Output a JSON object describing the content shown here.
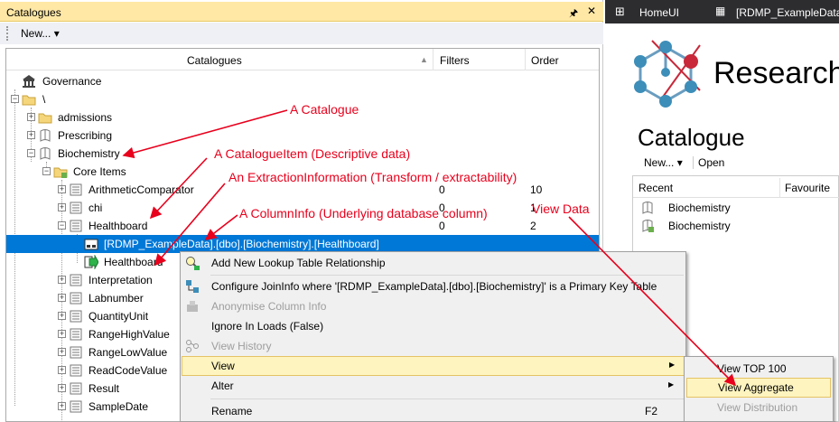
{
  "left_panel": {
    "title": "Catalogues",
    "pin_icon": "pin-icon",
    "close_icon": "close-icon",
    "toolbar": {
      "new_label": "New..."
    },
    "columns": {
      "catalogues": "Catalogues",
      "filters": "Filters",
      "order": "Order"
    },
    "tree": {
      "governance": "Governance",
      "root": "\\",
      "admissions": "admissions",
      "prescribing": "Prescribing",
      "biochemistry": "Biochemistry",
      "core_items": "Core Items",
      "items": [
        {
          "label": "ArithmeticComparator",
          "filters": "0",
          "order": "10"
        },
        {
          "label": "chi",
          "filters": "0",
          "order": "1"
        },
        {
          "label": "Healthboard",
          "filters": "0",
          "order": "2"
        }
      ],
      "selected_columninfo": "[RDMP_ExampleData].[dbo].[Biochemistry].[Healthboard]",
      "extraction": "Healthboard",
      "rest": [
        "Interpretation",
        "Labnumber",
        "QuantityUnit",
        "RangeHighValue",
        "RangeLowValue",
        "ReadCodeValue",
        "Result",
        "SampleDate"
      ]
    }
  },
  "right_panel": {
    "tabs": [
      "HomeUI",
      "[RDMP_ExampleData]"
    ],
    "logo_text": "Research",
    "catalogue_title": "Catalogue",
    "toolbar": {
      "new_label": "New...",
      "open_label": "Open"
    },
    "columns": {
      "recent": "Recent",
      "favourite": "Favourite"
    },
    "recent_items": [
      "Biochemistry",
      "Biochemistry"
    ]
  },
  "context_menu": {
    "items": [
      {
        "label": "Add New Lookup Table Relationship",
        "disabled": false
      },
      {
        "label": "Configure JoinInfo where '[RDMP_ExampleData].[dbo].[Biochemistry]' is a Primary Key Table",
        "disabled": false
      },
      {
        "label": "Anonymise Column Info",
        "disabled": true
      },
      {
        "label": "Ignore In Loads (False)",
        "disabled": false
      },
      {
        "label": "View History",
        "disabled": true
      },
      {
        "label": "View",
        "disabled": false
      },
      {
        "label": "Alter",
        "disabled": false
      },
      {
        "label": "Rename",
        "shortcut": "F2",
        "disabled": false
      }
    ],
    "submenu": [
      "View TOP 100",
      "View Aggregate",
      "View Distribution"
    ]
  },
  "annotations": [
    "A Catalogue",
    "A CatalogueItem (Descriptive data)",
    "An ExtractionInformation (Transform / extractability)",
    "A ColumnInfo (Underlying database column)",
    "View Data"
  ],
  "colors": {
    "selection": "#0078d7",
    "annotation": "#e8001c",
    "panel_title": "#ffe8a6",
    "menu_highlight": "#fdf4bf"
  }
}
